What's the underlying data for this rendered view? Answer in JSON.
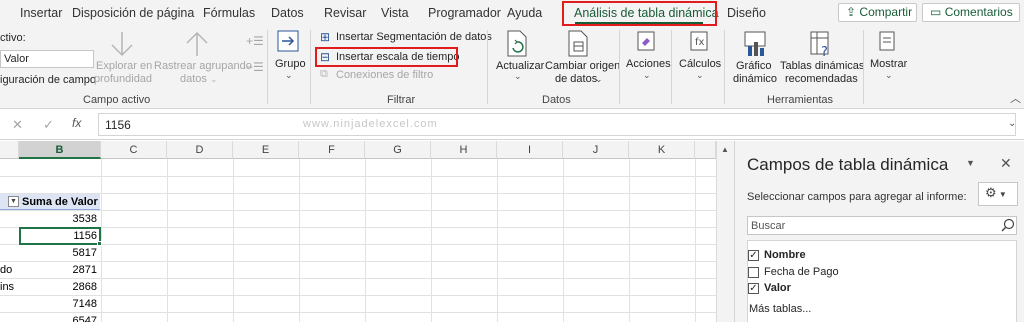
{
  "tabs": [
    "Insertar",
    "Disposición de página",
    "Fórmulas",
    "Datos",
    "Revisar",
    "Vista",
    "Programador",
    "Ayuda",
    "Análisis de tabla dinámica",
    "Diseño"
  ],
  "share_label": "Compartir",
  "comments_label": "Comentarios",
  "active_field": {
    "label": "ctivo:",
    "value": "Valor",
    "config_label": "iguración de campo",
    "explore_1": "Explorar en",
    "explore_2": "profundidad",
    "drill_1": "Rastrear agrupando",
    "drill_2": "datos",
    "group_label": "Campo activo"
  },
  "group": {
    "label": "Grupo"
  },
  "filter": {
    "insert_slicer": "Insertar Segmentación de datos",
    "insert_timeline": "Insertar escala de tiempo",
    "filter_connections": "Conexiones de filtro",
    "group_label": "Filtrar"
  },
  "data_group": {
    "refresh": "Actualizar",
    "change_source_1": "Cambiar origen",
    "change_source_2": "de datos",
    "group_label": "Datos"
  },
  "actions": {
    "label": "Acciones"
  },
  "calculations": {
    "label": "Cálculos"
  },
  "tools": {
    "pivotchart_1": "Gráfico",
    "pivotchart_2": "dinámico",
    "recommended_1": "Tablas dinámicas",
    "recommended_2": "recomendadas",
    "group_label": "Herramientas"
  },
  "show": {
    "label": "Mostrar"
  },
  "formula_bar": {
    "value": "1156",
    "watermark": "www.ninjadelexcel.com"
  },
  "columns": [
    "B",
    "C",
    "D",
    "E",
    "F",
    "G",
    "H",
    "I",
    "J",
    "K"
  ],
  "pivot": {
    "header": "Suma de Valor",
    "left_labels": [
      "",
      "",
      "",
      "do",
      "ins",
      "",
      ""
    ],
    "values": [
      "3538",
      "1156",
      "5817",
      "2871",
      "2868",
      "7148",
      "6547"
    ]
  },
  "pane": {
    "title": "Campos de tabla dinámica",
    "subtitle": "Seleccionar campos para agregar al informe:",
    "search_placeholder": "Buscar",
    "fields": [
      {
        "name": "Nombre",
        "checked": true
      },
      {
        "name": "Fecha de Pago",
        "checked": false
      },
      {
        "name": "Valor",
        "checked": true
      }
    ],
    "more_tables": "Más tablas..."
  }
}
